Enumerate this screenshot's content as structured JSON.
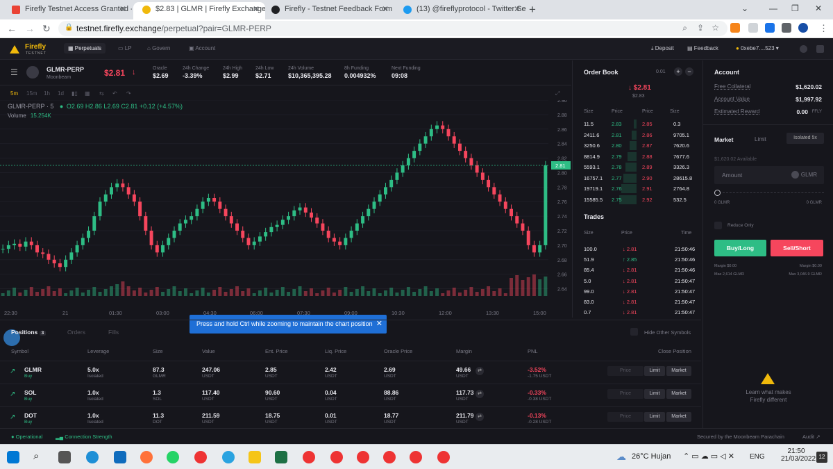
{
  "browser": {
    "tabs": [
      {
        "title": "Firefly Testnet Access Granted - ",
        "fav": "#ea4335"
      },
      {
        "title": "$2.83 | GLMR | Firefly Exchange",
        "fav": "#f0b90b"
      },
      {
        "title": "Firefly - Testnet Feedback Form",
        "fav": "#202124"
      },
      {
        "title": "(13) @fireflyprotocol - Twitter Se",
        "fav": "#1d9bf0"
      }
    ],
    "url_host": "testnet.firefly.exchange",
    "url_path": "/perpetual?pair=GLMR-PERP"
  },
  "nav": {
    "brand": "Firefly",
    "brand_sub": "TESTNET",
    "items": [
      "Perpetuals",
      "LP",
      "Govern",
      "Account"
    ],
    "deposit": "Deposit",
    "feedback": "Feedback",
    "wallet": "0xebe7....523"
  },
  "market": {
    "symbol": "GLMR-PERP",
    "chain": "Moonbeam",
    "price": "$2.81",
    "stats": [
      {
        "label": "Oracle",
        "value": "$2.69",
        "color": "#e8e8ee"
      },
      {
        "label": "24h Change",
        "value": "-3.39%",
        "color": "#f6465d"
      },
      {
        "label": "24h High",
        "value": "$2.99",
        "color": "#e8e8ee"
      },
      {
        "label": "24h Low",
        "value": "$2.71",
        "color": "#e8e8ee"
      },
      {
        "label": "24h Volume",
        "value": "$10,365,395.28",
        "color": "#e8e8ee"
      },
      {
        "label": "8h Funding",
        "value": "0.004932%",
        "color": "#2ebd85"
      },
      {
        "label": "Next Funding",
        "value": "09:08",
        "color": "#e8e8ee"
      }
    ]
  },
  "chart": {
    "timeframes": [
      "5m",
      "15m",
      "1h",
      "1d"
    ],
    "legend_symbol": "GLMR-PERP · 5",
    "ohlc": "O2.69 H2.86 L2.69 C2.81 +0.12 (+4.57%)",
    "volume_label": "Volume",
    "volume_value": "15.254K",
    "current_price": "2.81",
    "toast": "Press and hold Ctrl while zooming to maintain the chart position"
  },
  "chart_data": {
    "type": "candlestick",
    "x_ticks": [
      "22:30",
      "21",
      "01:30",
      "03:00",
      "04:30",
      "06:00",
      "07:30",
      "09:00",
      "10:30",
      "12:00",
      "13:30",
      "15:00"
    ],
    "y_ticks": [
      "2.90",
      "2.88",
      "2.86",
      "2.84",
      "2.82",
      "2.80",
      "2.78",
      "2.76",
      "2.74",
      "2.72",
      "2.70",
      "2.68",
      "2.66",
      "2.64"
    ],
    "ylim": [
      2.63,
      2.9
    ],
    "close": [
      2.695,
      2.7,
      2.702,
      2.698,
      2.705,
      2.7,
      2.69,
      2.688,
      2.68,
      2.675,
      2.67,
      2.68,
      2.69,
      2.7,
      2.71,
      2.72,
      2.74,
      2.76,
      2.77,
      2.78,
      2.785,
      2.78,
      2.77,
      2.76,
      2.74,
      2.72,
      2.7,
      2.69,
      2.7,
      2.71,
      2.72,
      2.73,
      2.735,
      2.74,
      2.75,
      2.76,
      2.765,
      2.76,
      2.75,
      2.74,
      2.73,
      2.72,
      2.71,
      2.7,
      2.705,
      2.712,
      2.718,
      2.725,
      2.728,
      2.735,
      2.74,
      2.748,
      2.752,
      2.745,
      2.738,
      2.73,
      2.72,
      2.71,
      2.705,
      2.7,
      2.71,
      2.72,
      2.73,
      2.74,
      2.75,
      2.76,
      2.77,
      2.78,
      2.79,
      2.8,
      2.81,
      2.82,
      2.83,
      2.84,
      2.85,
      2.86,
      2.865,
      2.86,
      2.85,
      2.84,
      2.83,
      2.82,
      2.81,
      2.8,
      2.79,
      2.78,
      2.77,
      2.76,
      2.75,
      2.74,
      2.73,
      2.72,
      2.7,
      2.69,
      2.7,
      2.81
    ]
  },
  "orderbook": {
    "title": "Order Book",
    "tick": "0.01",
    "mid": "↓ $2.81",
    "mid_sub": "$2.83",
    "headers": [
      "Size",
      "Price",
      "Price",
      "Size"
    ],
    "rows": [
      [
        "11.5",
        "2.83",
        "2.85",
        "0.3"
      ],
      [
        "2411.6",
        "2.81",
        "2.86",
        "9705.1"
      ],
      [
        "3250.6",
        "2.80",
        "2.87",
        "7620.6"
      ],
      [
        "8814.9",
        "2.79",
        "2.88",
        "7677.6"
      ],
      [
        "5593.1",
        "2.78",
        "2.89",
        "3326.3"
      ],
      [
        "16757.1",
        "2.77",
        "2.90",
        "28615.8"
      ],
      [
        "19719.1",
        "2.76",
        "2.91",
        "2764.8"
      ],
      [
        "15585.5",
        "2.75",
        "2.92",
        "532.5"
      ]
    ]
  },
  "trades": {
    "title": "Trades",
    "headers": [
      "Size",
      "Price",
      "Time"
    ],
    "rows": [
      {
        "size": "100.0",
        "price": "2.81",
        "dir": "down",
        "time": "21:50:46"
      },
      {
        "size": "51.9",
        "price": "2.85",
        "dir": "up",
        "time": "21:50:46"
      },
      {
        "size": "85.4",
        "price": "2.81",
        "dir": "down",
        "time": "21:50:46"
      },
      {
        "size": "5.0",
        "price": "2.81",
        "dir": "down",
        "time": "21:50:47"
      },
      {
        "size": "99.0",
        "price": "2.81",
        "dir": "down",
        "time": "21:50:47"
      },
      {
        "size": "83.0",
        "price": "2.81",
        "dir": "down",
        "time": "21:50:47"
      },
      {
        "size": "0.7",
        "price": "2.81",
        "dir": "down",
        "time": "21:50:47"
      }
    ]
  },
  "account": {
    "title": "Account",
    "rows": [
      {
        "label": "Free Collateral",
        "value": "$1,620.02"
      },
      {
        "label": "Account Value",
        "value": "$1,997.92"
      },
      {
        "label": "Estimated Reward",
        "value": "0.00",
        "unit": "FFLY"
      }
    ],
    "tabs": [
      "Market",
      "Limit"
    ],
    "margin_mode": "Isolated 5x",
    "available": "$1,620.02 Available",
    "amount_placeholder": "Amount",
    "amount_unit": "GLMR",
    "slider_min": "0 GLMR",
    "slider_max": "0 GLMR",
    "slider_level": 0,
    "reduce_only": "Reduce Only",
    "buy": "Buy/Long",
    "sell": "Sell/Short",
    "margin_buy": "Margin $0.00",
    "margin_sell": "Margin $0.00",
    "max_buy": "Max 2,614 GLMR",
    "max_sell": "Max 3,046.9 GLMR",
    "learn": "Learn what makes Firefly different"
  },
  "positions": {
    "tabs": [
      "Positions",
      "Orders",
      "Fills"
    ],
    "count": "3",
    "hide_other": "Hide Other Symbols",
    "headers": [
      "Symbol",
      "Leverage",
      "Size",
      "Value",
      "Ent. Price",
      "Liq. Price",
      "Oracle Price",
      "Margin",
      "PNL",
      "Close Position"
    ],
    "rows": [
      {
        "symbol": "GLMR",
        "side": "Buy",
        "lev": "5.0x",
        "mode": "Isolated",
        "size": "87.3",
        "size_u": "GLMR",
        "value": "247.06",
        "ent": "2.85",
        "liq": "2.42",
        "oracle": "2.69",
        "margin": "49.66",
        "pnl": "-3.52%",
        "pnl_abs": "-1.75  USDT"
      },
      {
        "symbol": "SOL",
        "side": "Buy",
        "lev": "1.0x",
        "mode": "Isolated",
        "size": "1.3",
        "size_u": "SOL",
        "value": "117.40",
        "ent": "90.60",
        "liq": "0.04",
        "oracle": "88.86",
        "margin": "117.73",
        "pnl": "-0.33%",
        "pnl_abs": "-0.38  USDT"
      },
      {
        "symbol": "DOT",
        "side": "Buy",
        "lev": "1.0x",
        "mode": "Isolated",
        "size": "11.3",
        "size_u": "DOT",
        "value": "211.59",
        "ent": "18.75",
        "liq": "0.01",
        "oracle": "18.77",
        "margin": "211.79",
        "pnl": "-0.13%",
        "pnl_abs": "-0.28  USDT"
      }
    ],
    "unit": "USDT",
    "btn_price": "Price",
    "btn_limit": "Limit",
    "btn_market": "Market"
  },
  "footer": {
    "status": "Operational",
    "conn": "Connection Strength",
    "secured": "Secured by the Moonbeam Parachain",
    "audit": "Audit"
  },
  "taskbar": {
    "weather": "26°C  Hujan",
    "lang": "ENG",
    "time": "21:50",
    "date": "21/03/2022",
    "notif": "12"
  },
  "colors": {
    "up": "#2ebd85",
    "down": "#f6465d",
    "accent": "#f0b90b"
  }
}
